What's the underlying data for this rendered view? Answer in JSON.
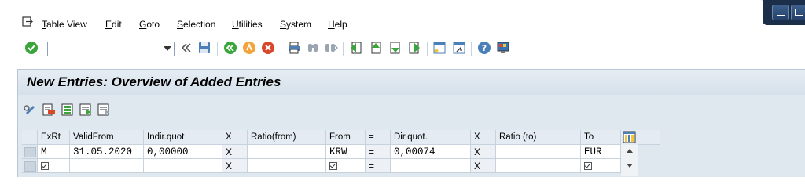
{
  "menu": {
    "items": [
      {
        "label": "Table View",
        "u": "T",
        "rest": "able View"
      },
      {
        "label": "Edit",
        "u": "E",
        "rest": "dit"
      },
      {
        "label": "Goto",
        "u": "G",
        "rest": "oto"
      },
      {
        "label": "Selection",
        "u": "S",
        "rest": "election"
      },
      {
        "label": "Utilities",
        "u": "U",
        "rest": "tilities"
      },
      {
        "label": "System",
        "u": "S",
        "rest": "ystem"
      },
      {
        "label": "Help",
        "u": "H",
        "rest": "elp"
      }
    ]
  },
  "toolbar": {
    "command_value": "",
    "icons": [
      "enter-icon",
      "back-icon",
      "save-icon",
      "back-nav-icon",
      "exit-icon",
      "cancel-icon",
      "print-icon",
      "find-icon",
      "find-next-icon",
      "first-page-icon",
      "previous-page-icon",
      "next-page-icon",
      "last-page-icon",
      "create-session-icon",
      "shortcut-icon",
      "help-icon",
      "customize-layout-icon"
    ]
  },
  "screen": {
    "title": "New Entries: Overview of Added Entries"
  },
  "table": {
    "columns": [
      "ExRt",
      "ValidFrom",
      "Indir.quot",
      "X",
      "Ratio(from)",
      "From",
      "=",
      "Dir.quot.",
      "X",
      "Ratio (to)",
      "To"
    ],
    "rows": [
      {
        "exrt": "M",
        "validfrom": "31.05.2020",
        "indir": "0,00000",
        "x1": "X",
        "ratiofrom": "",
        "from": "KRW",
        "eq": "=",
        "dir": "0,00074",
        "x2": "X",
        "ratioto": "",
        "to": "EUR"
      },
      {
        "exrt": "",
        "validfrom": "",
        "indir": "",
        "x1": "X",
        "ratiofrom": "",
        "from": "",
        "eq": "=",
        "dir": "",
        "x2": "X",
        "ratioto": "",
        "to": ""
      }
    ]
  },
  "colors": {
    "accent_blue": "#1c2f4a",
    "panel_bg": "#dfe7ef",
    "enter_green": "#3aa53a",
    "exit_orange": "#f2a33a",
    "cancel_red": "#d9472b"
  }
}
